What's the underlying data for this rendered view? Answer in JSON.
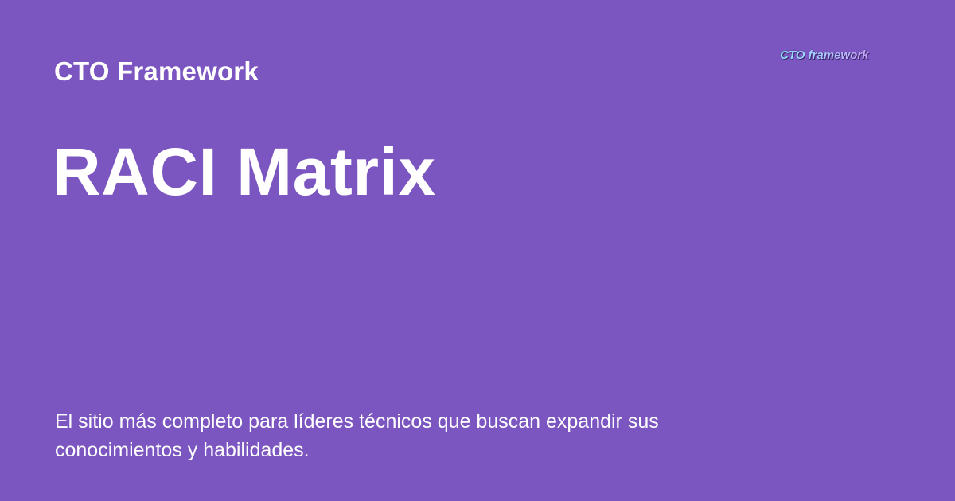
{
  "site": {
    "name": "CTO Framework"
  },
  "page": {
    "title": "RACI Matrix",
    "description": "El sitio más completo para líderes técnicos que buscan expandir sus conocimientos y habilidades."
  },
  "logo": {
    "text": "CTO framework",
    "colors": {
      "gradient_start": "#8fe3ff",
      "gradient_end": "#c9a6ff",
      "outline": "#3a2466"
    }
  },
  "colors": {
    "background": "#7b55c0",
    "text": "#ffffff"
  }
}
